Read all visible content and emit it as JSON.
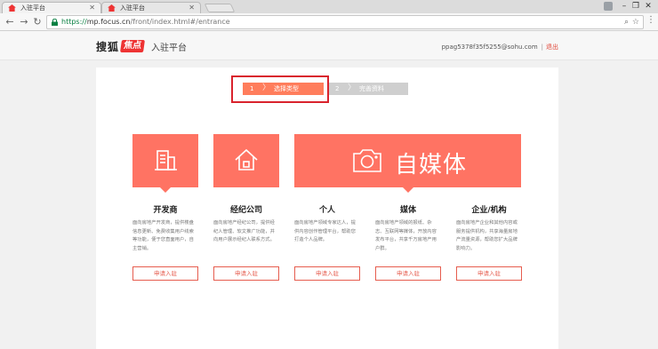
{
  "browser": {
    "tabs": [
      {
        "title": "入驻平台",
        "active": true
      },
      {
        "title": "入驻平台",
        "active": false
      }
    ],
    "url_scheme": "https://",
    "url_host": "mp.focus.cn",
    "url_path": "/front/index.html#/entrance",
    "window_controls": {
      "minimize": "–",
      "maximize": "❐",
      "close": "✕"
    }
  },
  "header": {
    "logo_text": "搜狐",
    "logo_badge": "焦点",
    "logo_subtitle": "入驻平台",
    "user_email": "ppag5378f35f5255@sohu.com",
    "separator": "|",
    "logout": "退出"
  },
  "steps": [
    {
      "number": "1",
      "label": "选择类型"
    },
    {
      "number": "2",
      "label": "完善资料"
    }
  ],
  "featured_banner_text": "自媒体",
  "categories": [
    {
      "title": "开发商",
      "desc": "面向房地产开发商，提供楼盘信息更新、免费收集用户线索等功能，便于您直面用户，自主营销。",
      "apply": "申请入驻"
    },
    {
      "title": "经纪公司",
      "desc": "面向房地产经纪公司，提供经纪人管理、软文推广功能，并向用户展示经纪人联系方式。",
      "apply": "申请入驻"
    },
    {
      "title": "个人",
      "desc": "面向房地产领域专家达人，提供内容创作管理平台，帮助您打造个人品牌。",
      "apply": "申请入驻"
    },
    {
      "title": "媒体",
      "desc": "面向房地产领域的报纸、杂志、互联网等媒体，开放内容发布平台，共享千万房地产用户群。",
      "apply": "申请入驻"
    },
    {
      "title": "企业/机构",
      "desc": "面向房地产企业和其他内容或服务提供机构，共享海量房地产流量资源，帮助您扩大品牌影响力。",
      "apply": "申请入驻"
    }
  ],
  "colors": {
    "accent": "#ff7363",
    "step_active": "#ff7d5c",
    "step_inactive": "#cfcfcf",
    "highlight": "#d9232d"
  }
}
